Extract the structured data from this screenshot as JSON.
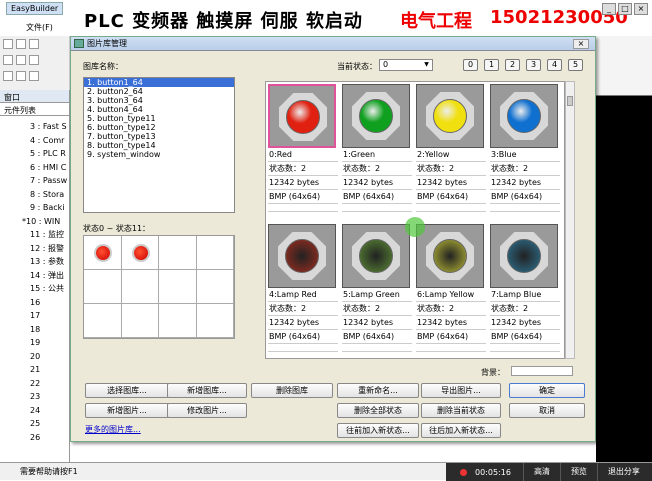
{
  "app": {
    "title": "EasyBuilder"
  },
  "banner": {
    "text": "PLC 变频器 触摸屏 伺服 软启动",
    "highlight": "电气工程",
    "phone": "15021230050"
  },
  "menu": {
    "file": "文件(F)"
  },
  "left": {
    "header": "窗口",
    "subheader": "元件列表",
    "items": [
      "3 : Fast S",
      "4 : Comr",
      "5 : PLC R",
      "6 : HMI C",
      "7 : Passw",
      "8 : Stora",
      "9 : Backi",
      "*10 : WIN",
      "11 : 监控",
      "12 : 报警",
      "13 : 参数",
      "14 : 弹出",
      "15 : 公共",
      "16",
      "17",
      "18",
      "19",
      "20",
      "21",
      "22",
      "23",
      "24",
      "25",
      "26"
    ]
  },
  "dialog": {
    "title": "图片库管理",
    "lib_label": "图库名称：",
    "libraries": [
      "1. button1_64",
      "2. button2_64",
      "3. button3_64",
      "4. button4_64",
      "5. button_type11",
      "6. button_type12",
      "7. button_type13",
      "8. button_type14",
      "9. system_window"
    ],
    "state_label": "状态0 ~ 状态11：",
    "cur_state_label": "当前状态：",
    "cur_state": "0",
    "state_buttons": [
      "0",
      "1",
      "2",
      "3",
      "4",
      "5"
    ],
    "pictures": [
      {
        "name": "0:Red",
        "states": "状态数：2",
        "size": "12342 bytes",
        "fmt": "BMP (64x64)",
        "color": "#e02010",
        "style": "flat"
      },
      {
        "name": "1:Green",
        "states": "状态数：2",
        "size": "12342 bytes",
        "fmt": "BMP (64x64)",
        "color": "#10a020",
        "style": "flat"
      },
      {
        "name": "2:Yellow",
        "states": "状态数：2",
        "size": "12342 bytes",
        "fmt": "BMP (64x64)",
        "color": "#f0e010",
        "style": "flat"
      },
      {
        "name": "3:Blue",
        "states": "状态数：2",
        "size": "12342 bytes",
        "fmt": "BMP (64x64)",
        "color": "#1070d0",
        "style": "flat"
      },
      {
        "name": "4:Lamp Red",
        "states": "状态数：2",
        "size": "12342 bytes",
        "fmt": "BMP (64x64)",
        "color": "#7a2a20",
        "style": "lamp"
      },
      {
        "name": "5:Lamp Green",
        "states": "状态数：2",
        "size": "12342 bytes",
        "fmt": "BMP (64x64)",
        "color": "#4a6a30",
        "style": "lamp"
      },
      {
        "name": "6:Lamp Yellow",
        "states": "状态数：2",
        "size": "12342 bytes",
        "fmt": "BMP (64x64)",
        "color": "#8a8a30",
        "style": "lamp"
      },
      {
        "name": "7:Lamp Blue",
        "states": "状态数：2",
        "size": "12342 bytes",
        "fmt": "BMP (64x64)",
        "color": "#2a5a70",
        "style": "lamp"
      }
    ],
    "bg_label": "背景：",
    "buttons": {
      "select_lib": "选择图库...",
      "new_lib": "新增图库...",
      "delete_lib": "删除图库",
      "rename": "重新命名...",
      "export": "导出图片...",
      "ok": "确定",
      "new_pic": "新增图片...",
      "modify_pic": "修改图片...",
      "delete_all_states": "删除全部状态",
      "delete_cur_state": "删除当前状态",
      "cancel": "取消",
      "insert_before": "往前加入新状态...",
      "insert_after": "往后加入新状态..."
    },
    "more_link": "更多的图片库..."
  },
  "status": {
    "help": "需要帮助请按F1",
    "time": "00:05:16",
    "tabs": [
      "高清",
      "预览",
      "退出分享"
    ]
  },
  "colors": {
    "accent": "#3a6fd8",
    "selection_border": "#e0529a",
    "red_text": "#e00000"
  }
}
